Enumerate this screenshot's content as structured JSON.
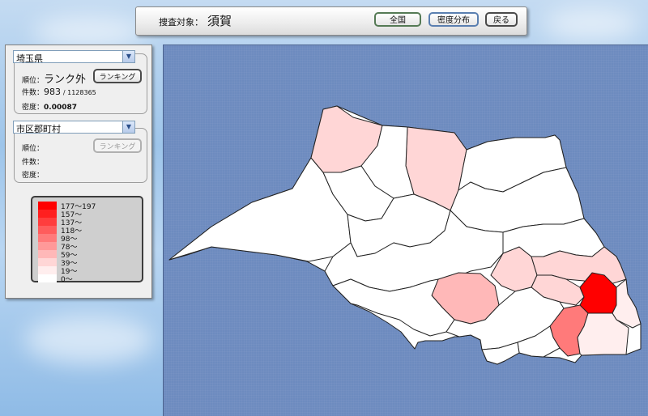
{
  "search": {
    "label": "捜査対象：",
    "target": "須賀"
  },
  "toolbar": {
    "nationwide_label": "全国",
    "density_label": "密度分布",
    "back_label": "戻る"
  },
  "prefecture": {
    "selected": "埼玉県",
    "rank_label": "順位：",
    "rank_value": "ランク外",
    "count_label": "件数：",
    "count_value": "983",
    "count_total": "/ 1128365",
    "density_label": "密度：",
    "density_value": "0.00087",
    "ranking_button": "ランキング"
  },
  "municipality": {
    "selected": "市区郡町村",
    "rank_label": "順位：",
    "count_label": "件数：",
    "density_label": "密度：",
    "ranking_button": "ランキング"
  },
  "legend": {
    "items": [
      {
        "label": "177〜197",
        "color": "#ff0000"
      },
      {
        "label": "157〜",
        "color": "#ff1f1f"
      },
      {
        "label": "137〜",
        "color": "#ff3d3d"
      },
      {
        "label": "118〜",
        "color": "#ff5c5c"
      },
      {
        "label": "98〜",
        "color": "#ff7a7a"
      },
      {
        "label": "78〜",
        "color": "#ff9999"
      },
      {
        "label": "59〜",
        "color": "#ffb8b8"
      },
      {
        "label": "39〜",
        "color": "#ffd6d6"
      },
      {
        "label": "19〜",
        "color": "#ffeeee"
      },
      {
        "label": "0〜",
        "color": "#ffffff"
      }
    ]
  },
  "map": {
    "region": "埼玉県",
    "colors": {
      "border": "#222222",
      "background": "#6d8bbf"
    }
  }
}
